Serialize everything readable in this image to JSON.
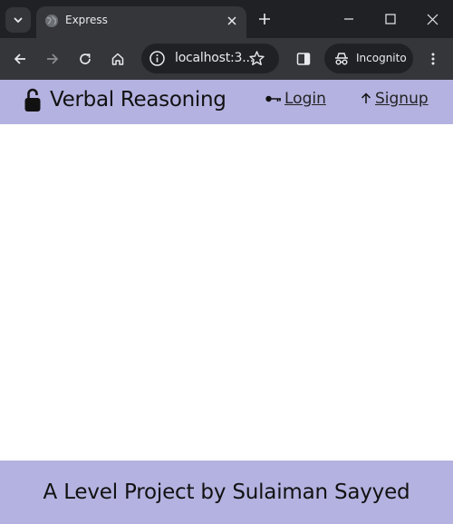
{
  "browser": {
    "tab": {
      "title": "Express",
      "favicon": "globe-icon"
    },
    "address": {
      "url_display": "localhost:3..."
    },
    "incognito_label": "Incognito",
    "colors": {
      "frame": "#202124",
      "toolbar": "#35363a",
      "text": "#e8eaed"
    }
  },
  "header": {
    "brand": "Verbal Reasoning",
    "brand_icon": "lock-icon",
    "nav": [
      {
        "label": "Login",
        "icon": "key-icon"
      },
      {
        "label": "Signup",
        "icon": "upload-arrow-icon"
      }
    ]
  },
  "footer": {
    "text": "A Level Project by Sulaiman Sayyed"
  },
  "theme": {
    "bar_color": "#b4b2e0",
    "text_color": "#111111"
  }
}
